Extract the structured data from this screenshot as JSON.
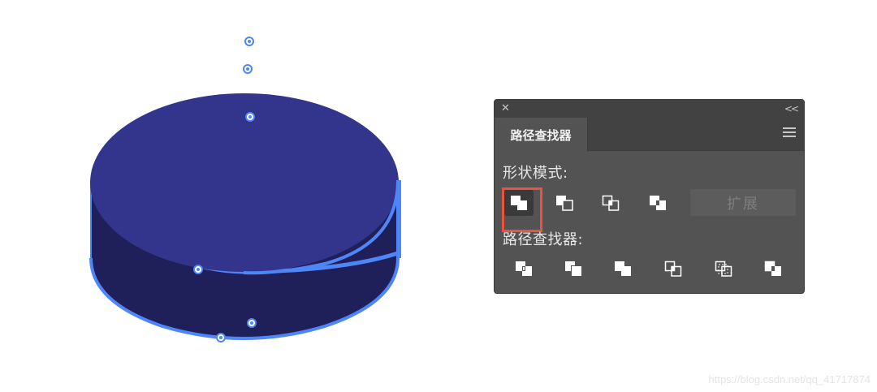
{
  "panel": {
    "close_icon": "close-icon",
    "collapse_label": "<<",
    "tab_label": "路径查找器",
    "menu_icon": "hamburger-menu-icon",
    "shape_modes": {
      "label": "形状模式:",
      "buttons": [
        {
          "name": "unite",
          "icon": "unite-icon",
          "selected": true
        },
        {
          "name": "minus-front",
          "icon": "minus-front-icon"
        },
        {
          "name": "intersect",
          "icon": "intersect-icon"
        },
        {
          "name": "exclude",
          "icon": "exclude-icon"
        }
      ],
      "expand_label": "扩展"
    },
    "pathfinders": {
      "label": "路径查找器:",
      "buttons": [
        {
          "name": "divide",
          "icon": "divide-icon"
        },
        {
          "name": "trim",
          "icon": "trim-icon"
        },
        {
          "name": "merge",
          "icon": "merge-icon"
        },
        {
          "name": "crop",
          "icon": "crop-icon"
        },
        {
          "name": "outline",
          "icon": "outline-icon"
        },
        {
          "name": "minus-back",
          "icon": "minus-back-icon"
        }
      ]
    }
  },
  "watermark": "https://blog.csdn.net/qq_41717874",
  "colors": {
    "cylinder_top": "#33348c",
    "cylinder_side": "#1f1f5a",
    "selection": "#4f86f7",
    "panel_bg": "#535353",
    "highlight": "#e8543c"
  }
}
